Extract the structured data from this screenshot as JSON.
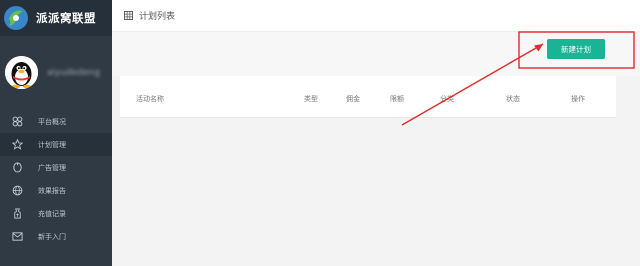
{
  "brand": {
    "name": "派派窝联盟"
  },
  "profile": {
    "username": "aiyudedeng"
  },
  "sidebar": {
    "items": [
      {
        "label": "平台概况",
        "icon": "dashboard-icon",
        "active": false
      },
      {
        "label": "计划管理",
        "icon": "star-icon",
        "active": true
      },
      {
        "label": "广告管理",
        "icon": "ad-icon",
        "active": false
      },
      {
        "label": "效果报告",
        "icon": "globe-icon",
        "active": false
      },
      {
        "label": "充值记录",
        "icon": "deposit-icon",
        "active": false
      },
      {
        "label": "新手入门",
        "icon": "mail-icon",
        "active": false
      }
    ]
  },
  "header": {
    "title": "计划列表",
    "icon": "grid-icon"
  },
  "toolbar": {
    "new_button_label": "新建计划"
  },
  "table": {
    "columns": [
      "活动名称",
      "类型",
      "佣金",
      "限额",
      "分类",
      "状态",
      "操作"
    ]
  },
  "colors": {
    "sidebar": "#2f3a44",
    "accent": "#1ab394",
    "annotation": "#e02b2b"
  }
}
